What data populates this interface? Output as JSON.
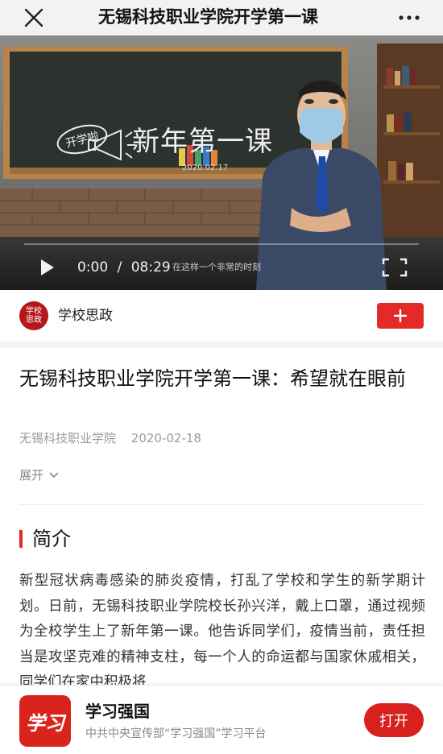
{
  "nav": {
    "title": "无锡科技职业学院开学第一课"
  },
  "video": {
    "chalkboard_badge": "开学啦",
    "chalkboard_title": "新年第一课",
    "chalkboard_date": "2020.02.17",
    "current_time": "0:00",
    "separator": "/",
    "duration": "08:29",
    "subtitle": "在这样一个非常的时刻",
    "progress": 0
  },
  "channel": {
    "avatar_text": "学校思政",
    "name": "学校思政",
    "follow_icon": "plus-icon"
  },
  "article": {
    "headline": "无锡科技职业学院开学第一课：希望就在眼前",
    "source": "无锡科技职业学院",
    "date": "2020-02-18",
    "expand_label": "展开"
  },
  "intro": {
    "heading": "简介",
    "text": "新型冠状病毒感染的肺炎疫情，打乱了学校和学生的新学期计划。日前，无锡科技职业学院校长孙兴洋，戴上口罩，通过视频为全校学生上了新年第一课。他告诉同学们，疫情当前，责任担当是攻坚克难的精神支柱，每一个人的命运都与国家休戚相关，同学们在家中积极将"
  },
  "banner": {
    "app_logo_text": "学习",
    "app_name": "学习强国",
    "app_desc": "中共中央宣传部“学习强国”学习平台",
    "open_label": "打开"
  },
  "colors": {
    "accent_red": "#e42a28",
    "banner_red": "#d8201e",
    "meta_gray": "#9a9a9a"
  }
}
